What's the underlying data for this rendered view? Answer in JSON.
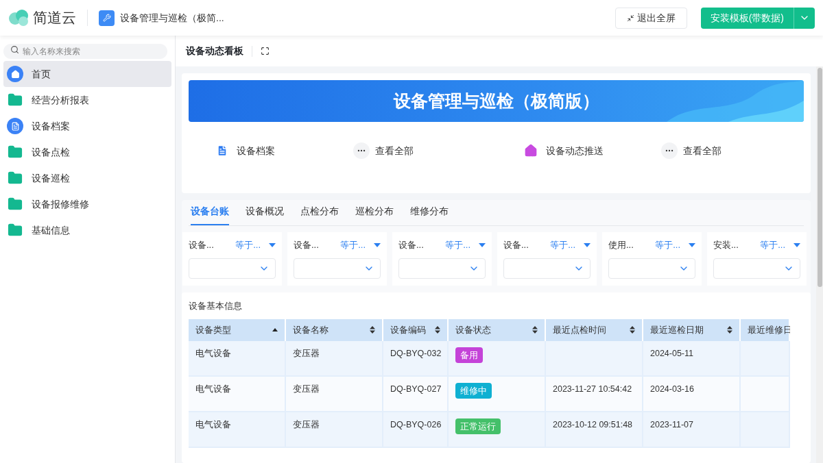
{
  "header": {
    "brand": "简道云",
    "app_title": "设备管理与巡检（极简...",
    "exit_button": "退出全屏",
    "install_button": "安装模板(带数据)"
  },
  "sidebar": {
    "search_placeholder": "输入名称来搜索",
    "items": [
      {
        "label": "首页",
        "kind": "home",
        "selected": true
      },
      {
        "label": "经营分析报表",
        "kind": "folder",
        "selected": false
      },
      {
        "label": "设备档案",
        "kind": "doc",
        "selected": false
      },
      {
        "label": "设备点检",
        "kind": "folder",
        "selected": false
      },
      {
        "label": "设备巡检",
        "kind": "folder",
        "selected": false
      },
      {
        "label": "设备报修维修",
        "kind": "folder",
        "selected": false
      },
      {
        "label": "基础信息",
        "kind": "folder",
        "selected": false
      }
    ]
  },
  "page_title": "设备动态看板",
  "banner": {
    "title": "设备管理与巡检（极简版）"
  },
  "shortcuts": [
    {
      "label": "设备档案",
      "kind": "doc",
      "more": "查看全部"
    },
    {
      "label": "设备动态推送",
      "kind": "home",
      "more": "查看全部"
    }
  ],
  "tabs": [
    {
      "label": "设备台账",
      "selected": true
    },
    {
      "label": "设备概况",
      "selected": false
    },
    {
      "label": "点检分布",
      "selected": false
    },
    {
      "label": "巡检分布",
      "selected": false
    },
    {
      "label": "维修分布",
      "selected": false
    }
  ],
  "filters": [
    {
      "label": "设备...",
      "operator": "等于..."
    },
    {
      "label": "设备...",
      "operator": "等于..."
    },
    {
      "label": "设备...",
      "operator": "等于..."
    },
    {
      "label": "设备...",
      "operator": "等于..."
    },
    {
      "label": "使用...",
      "operator": "等于..."
    },
    {
      "label": "安装...",
      "operator": "等于..."
    }
  ],
  "table": {
    "title": "设备基本信息",
    "columns": [
      {
        "label": "设备类型",
        "kind": "ascending"
      },
      {
        "label": "设备名称",
        "kind": "sortable"
      },
      {
        "label": "设备编码",
        "kind": "sortable"
      },
      {
        "label": "设备状态",
        "kind": "sortable"
      },
      {
        "label": "最近点检时间",
        "kind": "sortable"
      },
      {
        "label": "最近巡检日期",
        "kind": "sortable"
      },
      {
        "label": "最近维修日",
        "kind": "partial"
      }
    ],
    "rows": [
      {
        "type": "电气设备",
        "name": "变压器",
        "code": "DQ-BYQ-032",
        "status": "备用",
        "color": "#c443d8",
        "patrol_date": "2024-05-11"
      },
      {
        "type": "电气设备",
        "name": "变压器",
        "code": "DQ-BYQ-027",
        "status": "维修中",
        "color": "#0fb0d2",
        "inspect_time": "2023-11-27 10:54:42",
        "patrol_date": "2024-03-16"
      },
      {
        "type": "电气设备",
        "name": "变压器",
        "code": "DQ-BYQ-026",
        "status": "正常运行",
        "color": "#44c06a",
        "inspect_time": "2023-10-12 09:51:48",
        "patrol_date": "2023-11-07"
      }
    ]
  }
}
